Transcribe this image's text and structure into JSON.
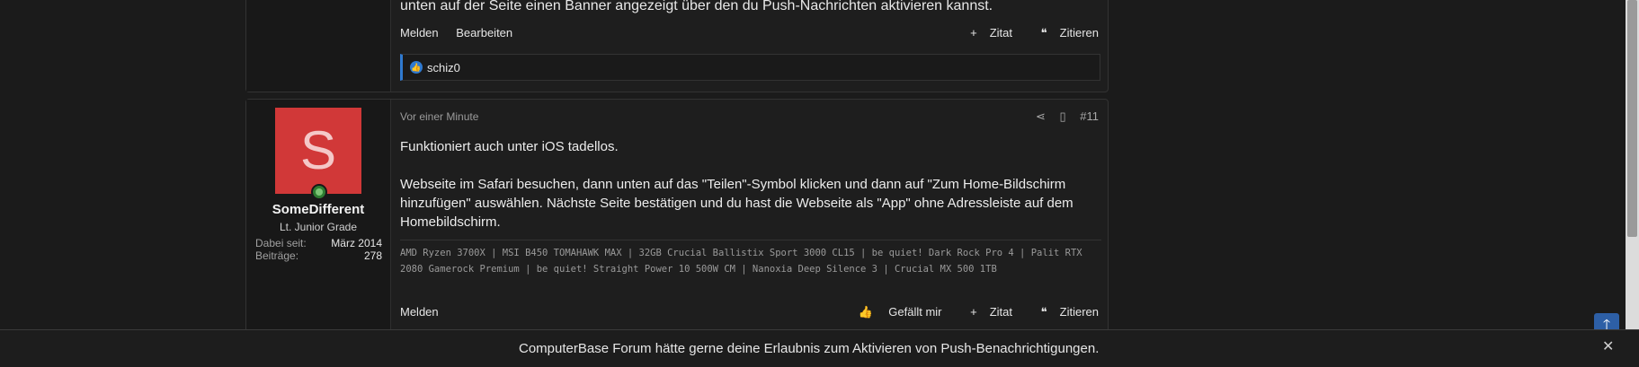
{
  "prev_post": {
    "text_tail": "unten auf der Seite einen Banner angezeigt über den du Push-Nachrichten aktivieren kannst.",
    "action_report": "Melden",
    "action_edit": "Bearbeiten",
    "action_quote": "Zitat",
    "action_cite": "Zitieren",
    "reaction_user": "schiz0"
  },
  "post": {
    "avatar_letter": "S",
    "username": "SomeDifferent",
    "user_title": "Lt. Junior Grade",
    "stats": [
      {
        "label": "Dabei seit:",
        "value": "März 2014"
      },
      {
        "label": "Beiträge:",
        "value": "278"
      }
    ],
    "timestamp": "Vor einer Minute",
    "post_number": "#11",
    "body": [
      "Funktioniert auch unter iOS tadellos.",
      "Webseite im Safari besuchen, dann unten auf das \"Teilen\"-Symbol klicken und dann auf \"Zum Home-Bildschirm hinzufügen\" auswählen. Nächste Seite bestätigen und du hast die Webseite als \"App\" ohne Adressleiste auf dem Homebildschirm."
    ],
    "signature": "AMD Ryzen 3700X | MSI B450 TOMAHAWK MAX | 32GB Crucial Ballistix Sport 3000 CL15 | be quiet! Dark Rock Pro 4 | Palit RTX 2080 Gamerock Premium | be quiet! Straight Power 10 500W CM | Nanoxia Deep Silence 3 | Crucial MX 500 1TB",
    "action_report": "Melden",
    "action_like": "Gefällt mir",
    "action_quote": "Zitat",
    "action_cite": "Zitieren"
  },
  "push_banner": {
    "text": "ComputerBase Forum hätte gerne deine Erlaubnis zum Aktivieren von Push-Benachrichtigungen."
  },
  "icons": {
    "share": "share-icon",
    "bookmark": "bookmark-icon",
    "plus": "plus-icon",
    "quote": "quote-icon",
    "thumbs_up": "thumbs-up-icon",
    "close": "close-icon",
    "arrow_up": "arrow-up-icon"
  },
  "colors": {
    "avatar_bg": "#d13838",
    "accent_blue": "#2f7ad0",
    "online_green": "#2e7d32"
  }
}
